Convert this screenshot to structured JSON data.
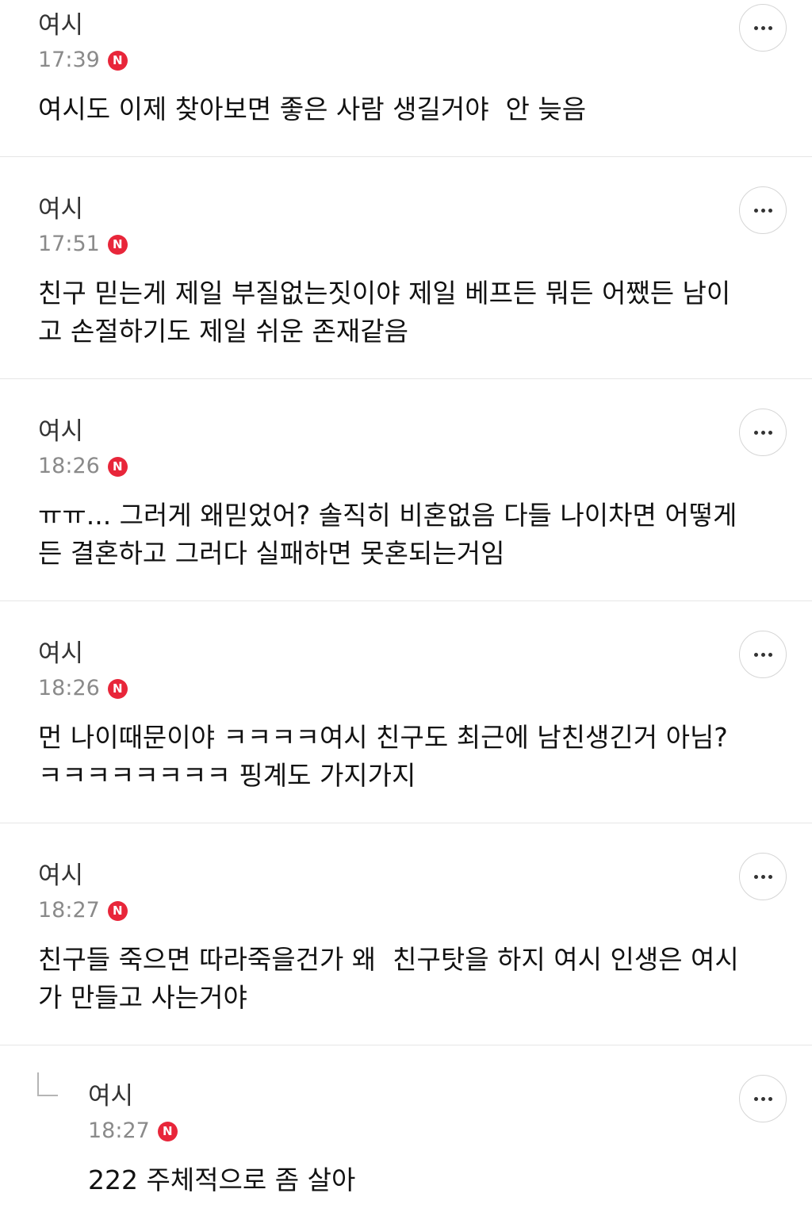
{
  "comments": [
    {
      "author": "여시",
      "time": "17:39",
      "badge": "N",
      "text": "여시도 이제 찾아보면 좋은 사람 생길거야  안 늦음"
    },
    {
      "author": "여시",
      "time": "17:51",
      "badge": "N",
      "text": "친구 믿는게 제일 부질없는짓이야 제일 베프든 뭐든 어쨌든 남이\n고 손절하기도 제일 쉬운 존재같음"
    },
    {
      "author": "여시",
      "time": "18:26",
      "badge": "N",
      "text": "ㅠㅠ... 그러게 왜믿었어? 솔직히 비혼없음 다들 나이차면 어떻게\n든 결혼하고 그러다 실패하면 못혼되는거임"
    },
    {
      "author": "여시",
      "time": "18:26",
      "badge": "N",
      "text": "먼 나이때문이야 ㅋㅋㅋㅋ여시 친구도 최근에 남친생긴거 아님?\nㅋㅋㅋㅋㅋㅋㅋㅋ 핑계도 가지가지"
    },
    {
      "author": "여시",
      "time": "18:27",
      "badge": "N",
      "text": "친구들 죽으면 따라죽을건가 왜  친구탓을 하지 여시 인생은 여시\n가 만들고 사는거야"
    }
  ],
  "reply": {
    "author": "여시",
    "time": "18:27",
    "badge": "N",
    "text": "222 주체적으로 좀 살아"
  },
  "icons": {
    "more": "more-horizontal-icon",
    "new": "new-badge-icon",
    "reply": "reply-arrow-icon"
  },
  "colors": {
    "badge": "#e8263a",
    "divider": "#e6e6e6",
    "time": "#8a8a8a"
  }
}
